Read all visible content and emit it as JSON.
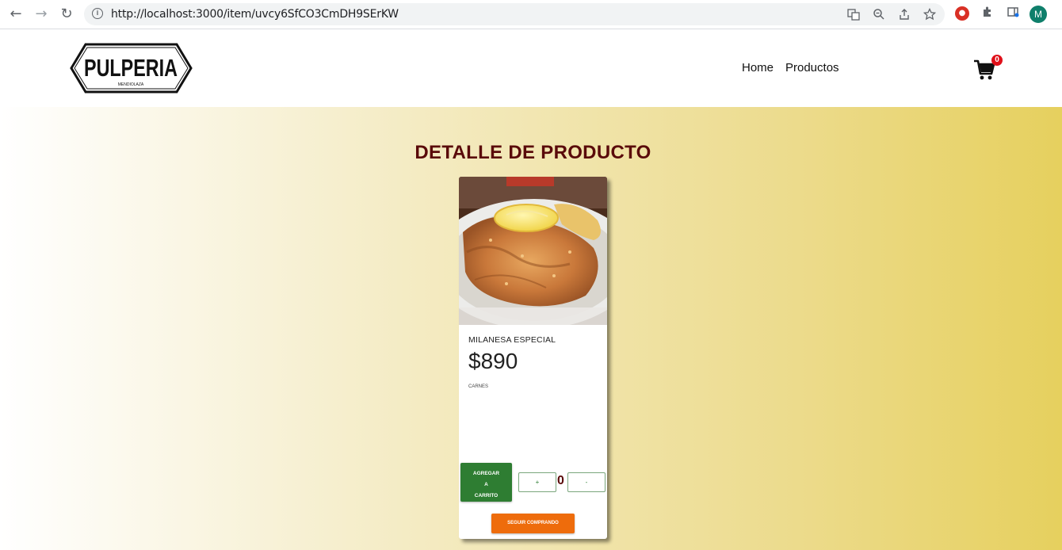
{
  "browser": {
    "back_icon": "←",
    "forward_icon": "→",
    "reload_icon": "↻",
    "url": "http://localhost:3000/item/uvcy6SfCO3CmDH9SErKW",
    "avatar_letter": "M"
  },
  "header": {
    "logo_text": "PULPERIA",
    "logo_subtext": "MENDIOLAZA",
    "nav": [
      "Home",
      "Productos"
    ],
    "cart_count": "0"
  },
  "page": {
    "title": "DETALLE DE PRODUCTO"
  },
  "product": {
    "name": "MILANESA ESPECIAL",
    "price": "$890",
    "category": "CARNES",
    "add_label": "AGREGAR A CARRITO",
    "add_lines": [
      "AGREGAR",
      "A",
      "CARRITO"
    ],
    "plus_label": "+",
    "minus_label": "-",
    "quantity": "0",
    "continue_label": "SEGUIR COMPRANDO"
  },
  "colors": {
    "title": "#5a0a0a",
    "add_button": "#2e7d32",
    "continue_button": "#ee6c0c",
    "cart_badge": "#e0101a"
  }
}
